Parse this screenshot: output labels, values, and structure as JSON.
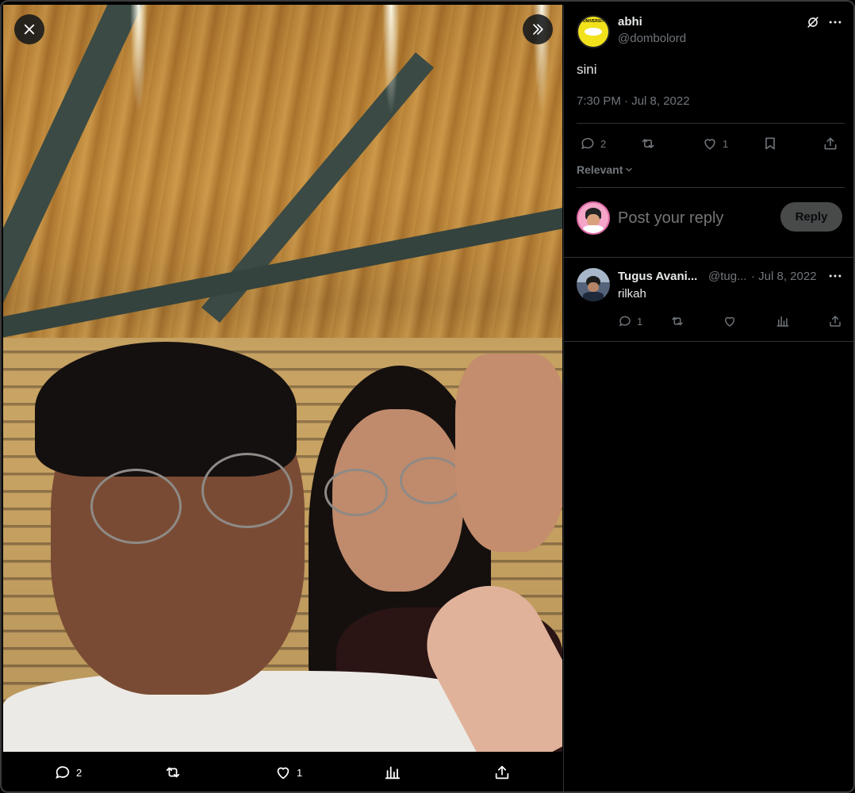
{
  "media": {
    "close_icon": "close-icon",
    "expand_icon": "chevron-double-right-icon",
    "actions": {
      "replies": "2",
      "likes": "1"
    }
  },
  "tweet": {
    "author_name": "abhi",
    "author_handle": "@dombolord",
    "avatar_text": "UNIVERSITY",
    "text": "sini",
    "timestamp": "7:30 PM · Jul 8, 2022",
    "replies_count": "2",
    "likes_count": "1",
    "sort_label": "Relevant"
  },
  "composer": {
    "placeholder": "Post your reply",
    "reply_label": "Reply"
  },
  "replies": [
    {
      "author_name": "Tugus Avani...",
      "author_handle": "@tug...",
      "date": "· Jul 8, 2022",
      "text": "rilkah",
      "replies_count": "1"
    }
  ],
  "colors": {
    "background": "#000000",
    "text": "#e7e9ea",
    "muted": "#71767b",
    "border": "#2f3336"
  }
}
